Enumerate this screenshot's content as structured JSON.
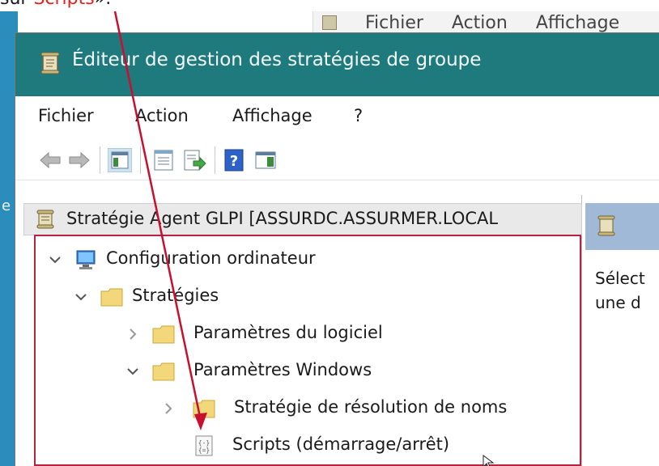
{
  "caption": {
    "prefix": "sur ",
    "highlight": "Scripts",
    "suffix": "»."
  },
  "background_window": {
    "menu": [
      "Fichier",
      "Action",
      "Affichage"
    ]
  },
  "desktop": {
    "letter": "e"
  },
  "window": {
    "title": "Éditeur de gestion des stratégies de groupe",
    "menu": [
      "Fichier",
      "Action",
      "Affichage",
      "?"
    ]
  },
  "tree": {
    "root": "Stratégie Agent GLPI [ASSURDC.ASSURMER.LOCAL",
    "nodes": [
      {
        "label": "Configuration ordinateur",
        "icon": "computer-icon",
        "expanded": true
      },
      {
        "label": "Stratégies",
        "icon": "folder-icon",
        "expanded": true
      },
      {
        "label": "Paramètres du logiciel",
        "icon": "folder-icon",
        "expanded": false
      },
      {
        "label": "Paramètres Windows",
        "icon": "folder-icon",
        "expanded": true
      },
      {
        "label": "Stratégie de résolution de noms",
        "icon": "folder-icon",
        "expanded": false
      },
      {
        "label": "Scripts (démarrage/arrêt)",
        "icon": "script-icon",
        "expanded": null
      }
    ]
  },
  "right_pane": {
    "line1": "Sélect",
    "line2": "une d"
  },
  "colors": {
    "titlebar": "#1f7a7e",
    "highlight": "#b8223e",
    "arrow": "#c8102e",
    "caption_red": "#e8201c"
  }
}
